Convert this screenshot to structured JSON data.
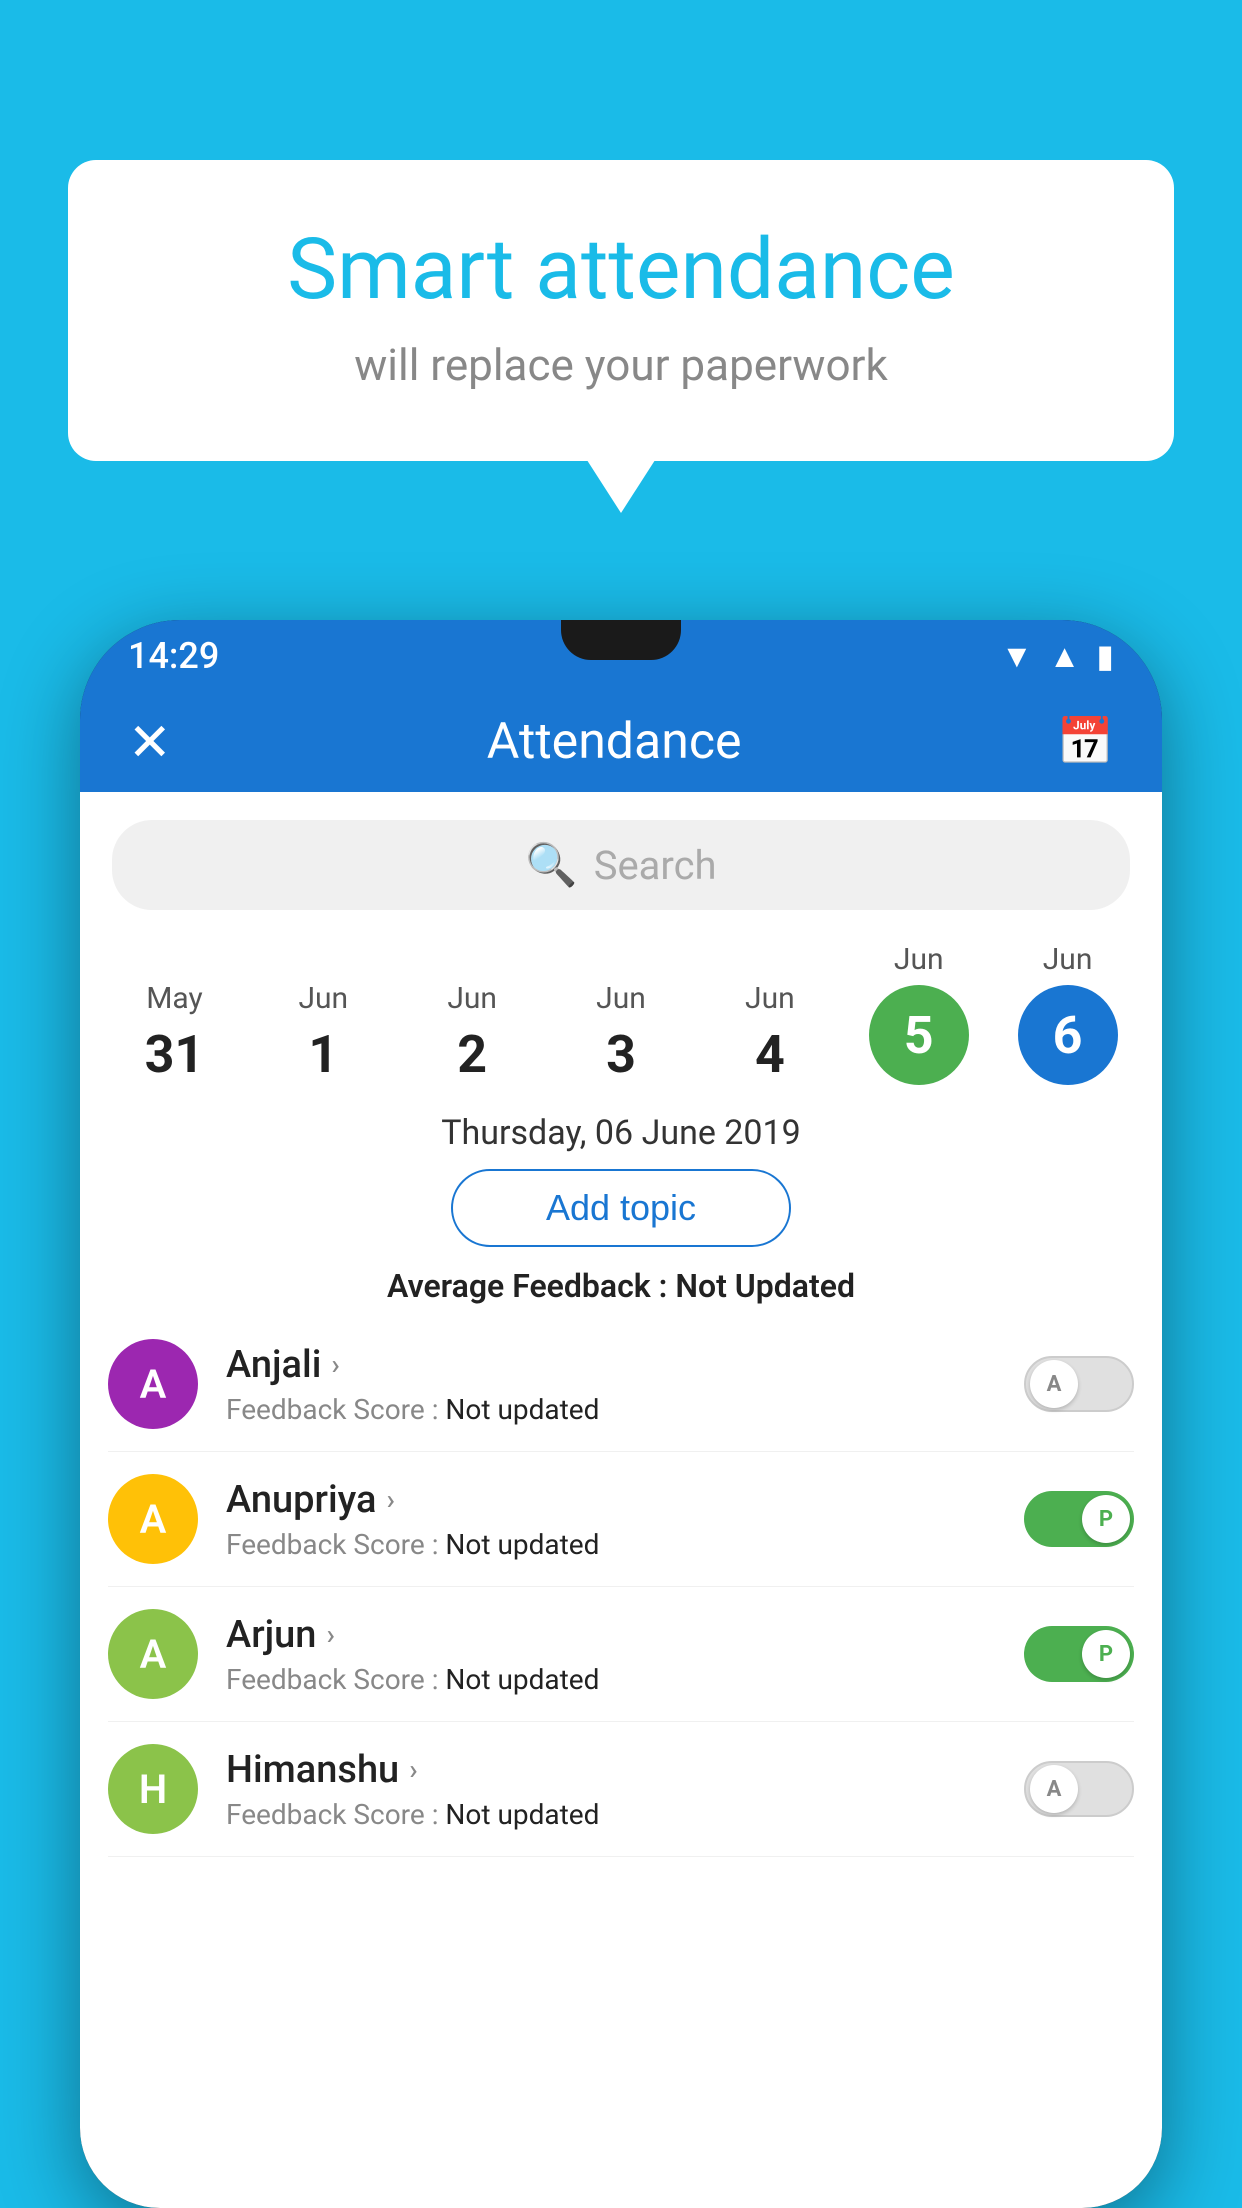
{
  "background_color": "#1ABBE8",
  "speech_bubble": {
    "title": "Smart attendance",
    "subtitle": "will replace your paperwork"
  },
  "phone": {
    "status_bar": {
      "time": "14:29",
      "wifi_icon": "▼",
      "signal_icon": "▲",
      "battery_icon": "▮"
    },
    "header": {
      "close_icon": "✕",
      "title": "Attendance",
      "calendar_icon": "📅"
    },
    "search": {
      "placeholder": "Search",
      "icon": "🔍"
    },
    "dates": [
      {
        "month": "May",
        "day": "31",
        "selected": ""
      },
      {
        "month": "Jun",
        "day": "1",
        "selected": ""
      },
      {
        "month": "Jun",
        "day": "2",
        "selected": ""
      },
      {
        "month": "Jun",
        "day": "3",
        "selected": ""
      },
      {
        "month": "Jun",
        "day": "4",
        "selected": ""
      },
      {
        "month": "Jun",
        "day": "5",
        "selected": "green"
      },
      {
        "month": "Jun",
        "day": "6",
        "selected": "blue"
      }
    ],
    "selected_date_text": "Thursday, 06 June 2019",
    "add_topic_label": "Add topic",
    "feedback_label": "Average Feedback : ",
    "feedback_value": "Not Updated",
    "students": [
      {
        "name": "Anjali",
        "initial": "A",
        "avatar_color": "#9C27B0",
        "feedback_label": "Feedback Score : ",
        "feedback_value": "Not updated",
        "toggle_state": "off",
        "toggle_label": "A"
      },
      {
        "name": "Anupriya",
        "initial": "A",
        "avatar_color": "#FFC107",
        "feedback_label": "Feedback Score : ",
        "feedback_value": "Not updated",
        "toggle_state": "on",
        "toggle_label": "P"
      },
      {
        "name": "Arjun",
        "initial": "A",
        "avatar_color": "#8BC34A",
        "feedback_label": "Feedback Score : ",
        "feedback_value": "Not updated",
        "toggle_state": "on",
        "toggle_label": "P"
      },
      {
        "name": "Himanshu",
        "initial": "H",
        "avatar_color": "#8BC34A",
        "feedback_label": "Feedback Score : ",
        "feedback_value": "Not updated",
        "toggle_state": "off",
        "toggle_label": "A"
      }
    ]
  }
}
